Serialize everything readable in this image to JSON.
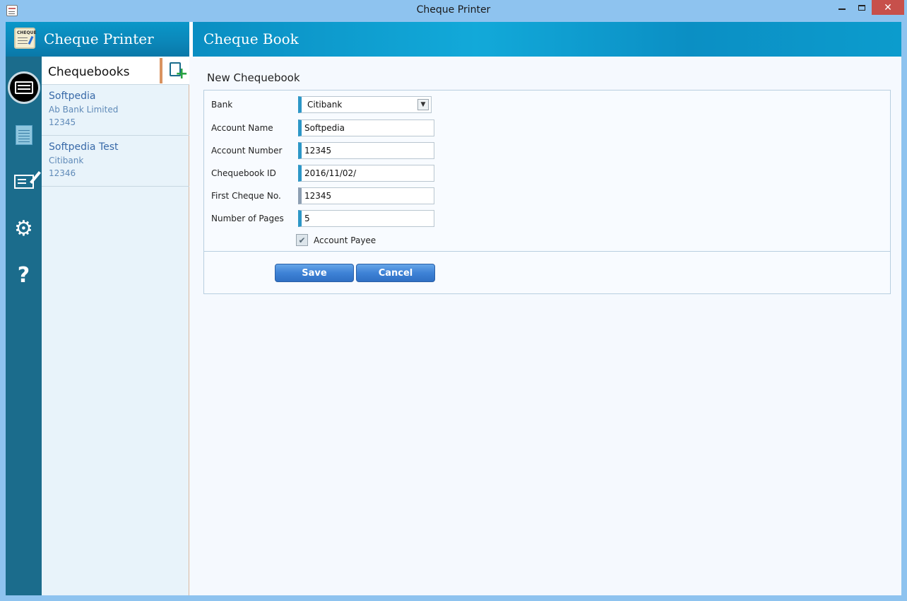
{
  "window": {
    "title": "Cheque Printer",
    "close_glyph": "✕"
  },
  "sidebar": {
    "app_name": "Cheque Printer",
    "logo_text": "CHEQUE",
    "icons": [
      "cheque-card-icon",
      "chequebook-icon",
      "write-cheque-icon",
      "settings-gear-icon",
      "help-icon"
    ],
    "help_glyph": "?",
    "gear_glyph": "⚙"
  },
  "chequebooks": {
    "header": "Chequebooks",
    "items": [
      {
        "name": "Softpedia",
        "bank": "Ab Bank Limited",
        "account": "12345"
      },
      {
        "name": "Softpedia Test",
        "bank": "Citibank",
        "account": "12346"
      }
    ]
  },
  "main": {
    "header": "Cheque Book",
    "section_title": "New Chequebook",
    "form": {
      "bank_label": "Bank",
      "bank_value": "Citibank",
      "account_name_label": "Account Name",
      "account_name_value": "Softpedia",
      "account_number_label": "Account Number",
      "account_number_value": "12345",
      "chequebook_id_label": "Chequebook ID",
      "chequebook_id_value": "2016/11/02/",
      "first_cheque_label": "First Cheque No.",
      "first_cheque_value": "12345",
      "pages_label": "Number of Pages",
      "pages_value": "5",
      "account_payee_label": "Account Payee",
      "account_payee_checked": true,
      "check_glyph": "✔",
      "dropdown_glyph": "▼"
    },
    "buttons": {
      "save": "Save",
      "cancel": "Cancel"
    }
  },
  "colors": {
    "accent": "#0a97c9",
    "rail": "#1b6c8c",
    "field_marker": "#2d97c7"
  }
}
